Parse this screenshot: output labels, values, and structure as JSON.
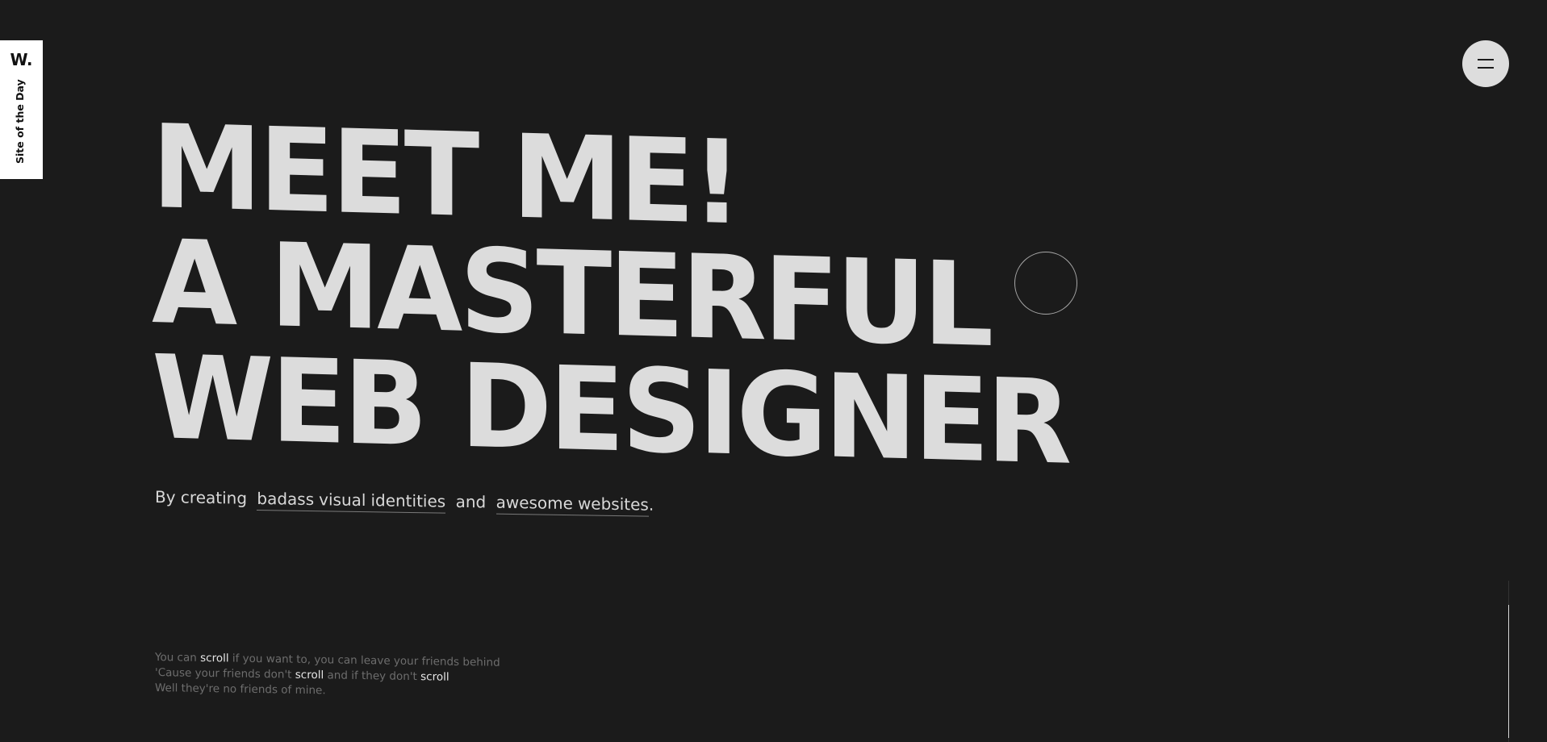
{
  "badge": {
    "logo": "W.",
    "label": "Site of the Day"
  },
  "menu": {
    "icon": "hamburger-menu-icon"
  },
  "headline": {
    "line1": "MEET ME!",
    "line2": "A MASTERFUL",
    "line3": "WEB DESIGNER"
  },
  "subtitle": {
    "prefix": "By creating",
    "link1_word1": "badass",
    "link1_word2": "visual",
    "link1_word3": "identities",
    "middle": "and",
    "link2_word1": "awesome",
    "link2_word2": "websites",
    "suffix": "."
  },
  "lyrics": {
    "l1_a": "You can ",
    "l1_b": "scroll",
    "l1_c": " if you want to, you can leave your friends behind",
    "l2_a": "'Cause your friends don't ",
    "l2_b": "scroll",
    "l2_c": " and if they don't ",
    "l2_d": "scroll",
    "l3": "Well they're no friends of mine."
  },
  "colors": {
    "background": "#1b1b1b",
    "headline": "#dcdcdc",
    "badge_bg": "#ffffff",
    "menu_bg": "#dddddd"
  }
}
